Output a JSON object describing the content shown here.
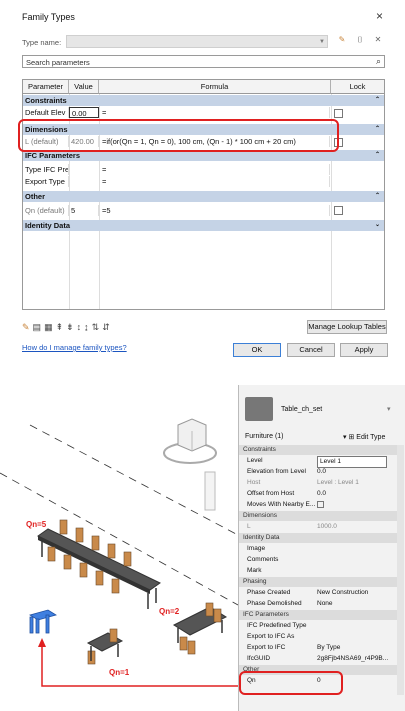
{
  "dialog": {
    "title": "Family Types",
    "close_glyph": "×",
    "type_name_label": "Type name:",
    "search_placeholder": "Search parameters",
    "columns": {
      "parameter": "Parameter",
      "value": "Value",
      "formula": "Formula",
      "lock": "Lock"
    },
    "sections": {
      "constraints": "Constraints",
      "dimensions": "Dimensions",
      "ifc": "IFC Parameters",
      "other": "Other",
      "identity": "Identity Data"
    },
    "rows": {
      "default_elev": {
        "name": "Default Elev",
        "value": "0.00",
        "formula": "="
      },
      "l_default": {
        "name": "L (default)",
        "value": "420.00",
        "formula": "=if(or(Qn = 1, Qn = 0), 100 cm, (Qn - 1) * 100 cm + 20 cm)"
      },
      "type_ifc": {
        "name": "Type IFC Pre",
        "value": "",
        "formula": "="
      },
      "export_type": {
        "name": "Export Type",
        "value": "",
        "formula": "="
      },
      "qn_default": {
        "name": "Qn (default)",
        "value": "5",
        "formula": "=5"
      }
    },
    "manage_lookup": "Manage Lookup Tables",
    "help_link": "How do I manage family types?",
    "ok": "OK",
    "cancel": "Cancel",
    "apply": "Apply"
  },
  "properties": {
    "family_name": "Table_ch_set",
    "category": "Furniture (1)",
    "edit_type": "Edit Type",
    "groups": {
      "constraints": "Constraints",
      "dimensions": "Dimensions",
      "identity": "Identity Data",
      "phasing": "Phasing",
      "ifc": "IFC Parameters",
      "other": "Other"
    },
    "rows": {
      "level": {
        "k": "Level",
        "v": "Level 1"
      },
      "elev": {
        "k": "Elevation from Level",
        "v": "0.0"
      },
      "host": {
        "k": "Host",
        "v": "Level : Level 1"
      },
      "offset": {
        "k": "Offset from Host",
        "v": "0.0"
      },
      "moves": {
        "k": "Moves With Nearby E...",
        "v": ""
      },
      "l": {
        "k": "L",
        "v": "1000.0"
      },
      "image": {
        "k": "Image",
        "v": ""
      },
      "comments": {
        "k": "Comments",
        "v": ""
      },
      "mark": {
        "k": "Mark",
        "v": ""
      },
      "phase_created": {
        "k": "Phase Created",
        "v": "New Construction"
      },
      "phase_demolished": {
        "k": "Phase Demolished",
        "v": "None"
      },
      "ifc_predef": {
        "k": "IFC Predefined Type",
        "v": ""
      },
      "export_ifc_as": {
        "k": "Export to IFC As",
        "v": ""
      },
      "export_ifc": {
        "k": "Export to IFC",
        "v": "By Type"
      },
      "ifcguid": {
        "k": "IfcGUID",
        "v": "2g8Fjb4NSA69_r4P9B..."
      },
      "qn": {
        "k": "Qn",
        "v": "0"
      }
    }
  },
  "labels": {
    "qn5": "Qn=5",
    "qn2": "Qn=2",
    "qn1": "Qn=1"
  },
  "colors": {
    "highlight": "#e02020",
    "section": "#c5d3e6",
    "chair_blue": "#3f7fe0"
  }
}
